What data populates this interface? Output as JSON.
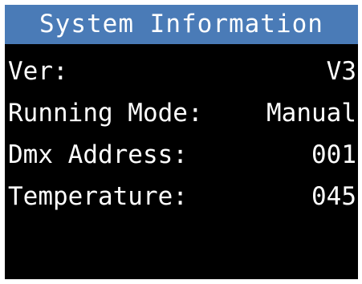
{
  "screen": {
    "title": "System Information",
    "rows": [
      {
        "label": "Ver:",
        "value": "V3"
      },
      {
        "label": "Running Mode:",
        "value": "Manual"
      },
      {
        "label": "Dmx Address:",
        "value": "001"
      },
      {
        "label": "Temperature:",
        "value": "045"
      }
    ]
  },
  "colors": {
    "title_bar": "#4a7bb7",
    "background": "#000000",
    "text": "#ffffff"
  }
}
